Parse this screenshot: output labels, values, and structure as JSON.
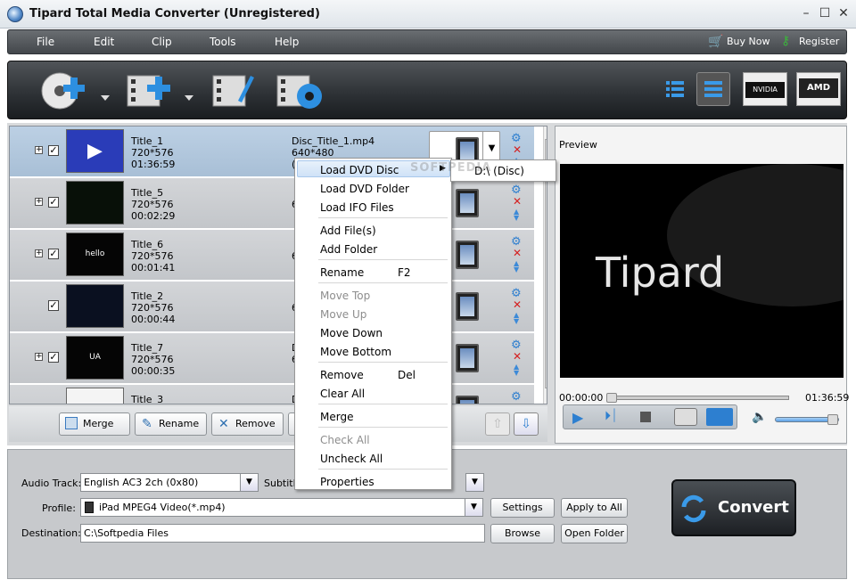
{
  "window": {
    "title": "Tipard Total Media Converter (Unregistered)"
  },
  "menu": {
    "items": [
      "File",
      "Edit",
      "Clip",
      "Tools",
      "Help"
    ],
    "buy_now": "Buy Now",
    "register": "Register"
  },
  "toolbar": {
    "icons": [
      "add-disc-icon",
      "add-video-icon",
      "edit-video-icon",
      "video-settings-icon",
      "list-view-icon",
      "detail-view-icon",
      "nvidia-icon",
      "amd-icon"
    ],
    "nvidia_label": "NVIDIA",
    "amd_label": "AMD"
  },
  "files": [
    {
      "title": "Title_1",
      "res": "720*576",
      "dur": "01:36:59",
      "out": "Disc_Title_1.mp4",
      "out_res": "640*480",
      "out_extra": "(",
      "selected": true,
      "expandable": true
    },
    {
      "title": "Title_5",
      "res": "720*576",
      "dur": "00:02:29",
      "out": "",
      "out_res": "6",
      "out_extra": "",
      "selected": false,
      "expandable": true
    },
    {
      "title": "Title_6",
      "res": "720*576",
      "dur": "00:01:41",
      "out": "",
      "out_res": "6",
      "out_extra": "",
      "selected": false,
      "expandable": true
    },
    {
      "title": "Title_2",
      "res": "720*576",
      "dur": "00:00:44",
      "out": "",
      "out_res": "6",
      "out_extra": "",
      "selected": false,
      "expandable": false
    },
    {
      "title": "Title_7",
      "res": "720*576",
      "dur": "00:00:35",
      "out": "D",
      "out_res": "6",
      "out_extra": "",
      "selected": false,
      "expandable": true
    },
    {
      "title": "Title_3",
      "res": "",
      "dur": "",
      "out": "D",
      "out_res": "",
      "out_extra": "",
      "selected": false,
      "expandable": false
    }
  ],
  "list_buttons": {
    "merge": "Merge",
    "rename": "Rename",
    "remove": "Remove"
  },
  "preview": {
    "label": "Preview",
    "time_start": "00:00:00",
    "time_end": "01:36:59",
    "brand": "Tipard",
    "volume": 1.0
  },
  "context_menu": {
    "items": [
      {
        "label": "Load DVD Disc",
        "shortcut": "",
        "disabled": false,
        "submenu": true
      },
      {
        "label": "Load DVD Folder",
        "shortcut": "",
        "disabled": false
      },
      {
        "label": "Load IFO Files",
        "shortcut": "",
        "disabled": false
      },
      {
        "label": "Add File(s)",
        "shortcut": "",
        "disabled": false
      },
      {
        "label": "Add Folder",
        "shortcut": "",
        "disabled": false
      },
      {
        "label": "Rename",
        "shortcut": "F2",
        "disabled": false
      },
      {
        "label": "Move Top",
        "shortcut": "",
        "disabled": true
      },
      {
        "label": "Move Up",
        "shortcut": "",
        "disabled": true
      },
      {
        "label": "Move Down",
        "shortcut": "",
        "disabled": false
      },
      {
        "label": "Move Bottom",
        "shortcut": "",
        "disabled": false
      },
      {
        "label": "Remove",
        "shortcut": "Del",
        "disabled": false
      },
      {
        "label": "Clear All",
        "shortcut": "",
        "disabled": false
      },
      {
        "label": "Merge",
        "shortcut": "",
        "disabled": false
      },
      {
        "label": "Check All",
        "shortcut": "",
        "disabled": true
      },
      {
        "label": "Uncheck All",
        "shortcut": "",
        "disabled": false
      },
      {
        "label": "Properties",
        "shortcut": "",
        "disabled": false
      }
    ],
    "submenu_item": "D:\\ (Disc)"
  },
  "watermark": "SOFTPEDIA",
  "settings": {
    "audio_track_label": "Audio Track:",
    "audio_track_value": "English AC3 2ch (0x80)",
    "subtitle_label": "Subtitle",
    "profile_label": "Profile:",
    "profile_value": "iPad MPEG4 Video(*.mp4)",
    "destination_label": "Destination:",
    "destination_value": "C:\\Softpedia Files",
    "settings_button": "Settings",
    "apply_all_button": "Apply to All",
    "browse_button": "Browse",
    "open_folder_button": "Open Folder",
    "convert_button": "Convert"
  },
  "colors": {
    "accent": "#2e7fcf",
    "remove": "#d42020",
    "buy_green": "#3cb43c"
  }
}
